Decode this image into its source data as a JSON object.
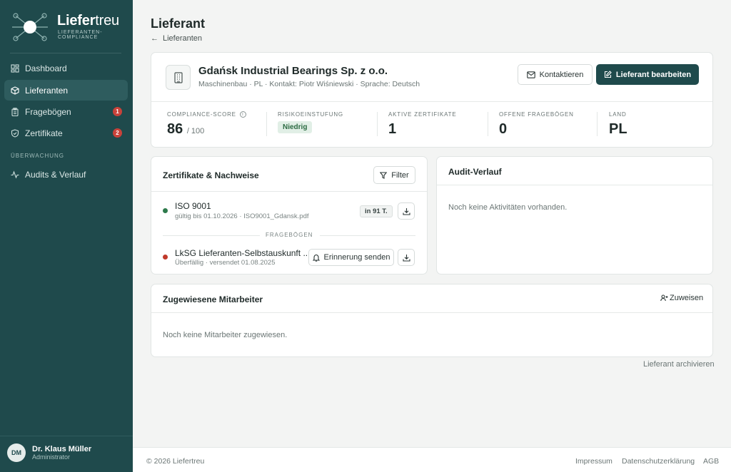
{
  "brand": {
    "name_bold": "Liefer",
    "name_light": "treu",
    "subtitle": "LIEFERANTEN-COMPLIANCE"
  },
  "sidebar": {
    "items": [
      {
        "label": "Dashboard",
        "icon": "dashboard-grid-icon"
      },
      {
        "label": "Lieferanten",
        "icon": "cube-icon",
        "active": true
      },
      {
        "label": "Fragebögen",
        "icon": "clipboard-icon",
        "badge": "1"
      },
      {
        "label": "Zertifikate",
        "icon": "shield-check-icon",
        "badge": "2"
      }
    ],
    "section_label": "ÜBERWACHUNG",
    "section_items": [
      {
        "label": "Audits & Verlauf",
        "icon": "activity-icon"
      }
    ]
  },
  "user": {
    "initials": "DM",
    "name": "Dr. Klaus Müller",
    "role": "Administrator"
  },
  "page": {
    "title": "Lieferant",
    "back_label": "Lieferanten"
  },
  "supplier": {
    "name": "Gdańsk Industrial Bearings Sp. z o.o.",
    "meta": "Maschinenbau · PL · Kontakt: Piotr Wiśniewski · Sprache: Deutsch",
    "contact_button": "Kontaktieren",
    "edit_button": "Lieferant bearbeiten"
  },
  "stats": {
    "compliance_label": "COMPLIANCE-SCORE",
    "compliance_value": "86",
    "compliance_suffix": "/ 100",
    "risk_label": "RISIKOEINSTUFUNG",
    "risk_value": "Niedrig",
    "certs_label": "AKTIVE ZERTIFIKATE",
    "certs_value": "1",
    "questionnaires_label": "OFFENE FRAGEBÖGEN",
    "questionnaires_value": "0",
    "country_label": "LAND",
    "country_value": "PL"
  },
  "certificates": {
    "title": "Zertifikate & Nachweise",
    "filter_label": "Filter",
    "items": [
      {
        "title": "ISO 9001",
        "subtitle": "gültig bis 01.10.2026 · ISO9001_Gdansk.pdf",
        "status_color": "#2d7a4b",
        "days": "in 91 T."
      }
    ],
    "section_label": "FRAGEBÖGEN",
    "questionnaires": [
      {
        "title": "LkSG Lieferanten-Selbstauskunft ...",
        "subtitle": "Überfällig · versendet 01.08.2025",
        "status_color": "#c0392b",
        "action": "Erinnerung senden"
      }
    ]
  },
  "audit": {
    "title": "Audit-Verlauf",
    "empty": "Noch keine Aktivitäten vorhanden."
  },
  "employees": {
    "title": "Zugewiesene Mitarbeiter",
    "assign_label": "Zuweisen",
    "empty": "Noch keine Mitarbeiter zugewiesen."
  },
  "archive_label": "Lieferant archivieren",
  "footer": {
    "copyright": "© 2026 Liefertreu",
    "links": [
      "Impressum",
      "Datenschutzerklärung",
      "AGB"
    ]
  }
}
